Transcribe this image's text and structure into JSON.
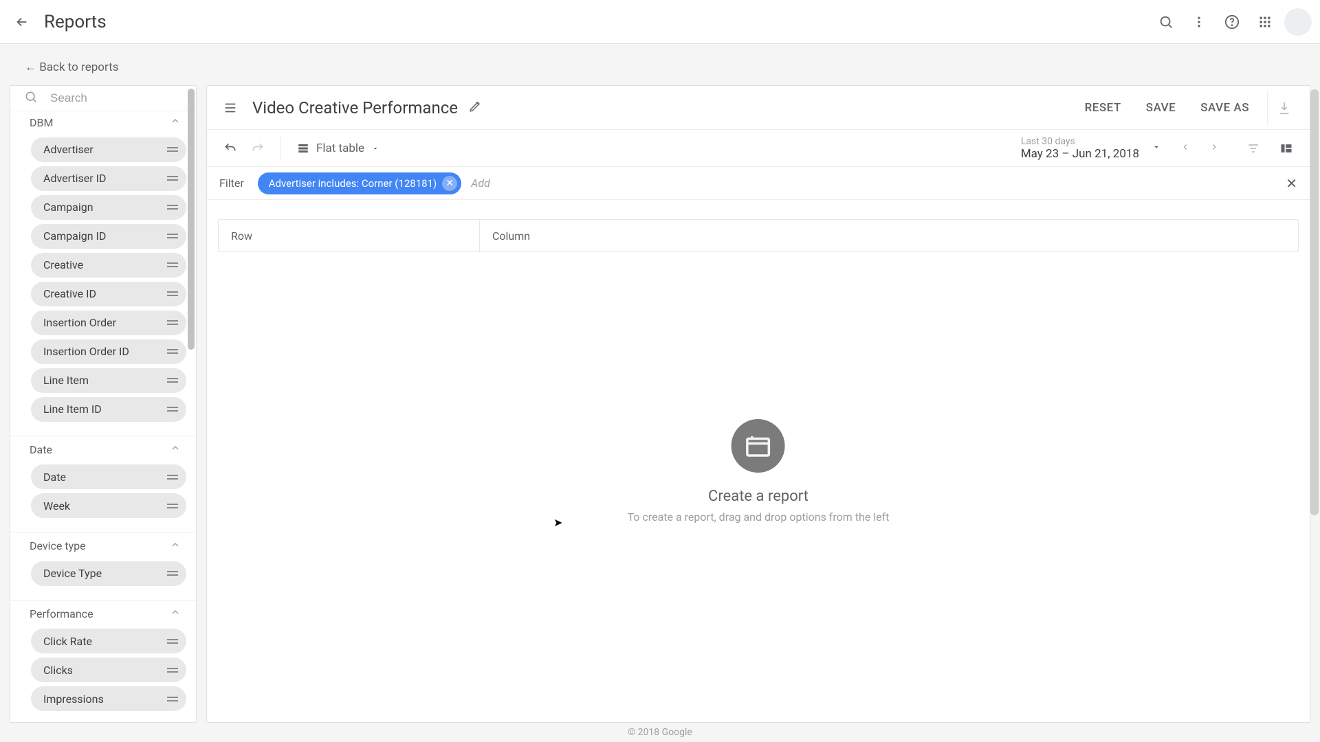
{
  "topbar": {
    "title": "Reports"
  },
  "breadcrumb": "← Back to reports",
  "search": {
    "placeholder": "Search"
  },
  "sidebar": {
    "groups": [
      {
        "name": "DBM",
        "items": [
          "Advertiser",
          "Advertiser ID",
          "Campaign",
          "Campaign ID",
          "Creative",
          "Creative ID",
          "Insertion Order",
          "Insertion Order ID",
          "Line Item",
          "Line Item ID"
        ]
      },
      {
        "name": "Date",
        "items": [
          "Date",
          "Week"
        ]
      },
      {
        "name": "Device type",
        "items": [
          "Device Type"
        ]
      },
      {
        "name": "Performance",
        "items": [
          "Click Rate",
          "Clicks",
          "Impressions"
        ]
      }
    ]
  },
  "report": {
    "title": "Video Creative Performance",
    "actions": {
      "reset": "RESET",
      "save": "SAVE",
      "save_as": "SAVE AS"
    }
  },
  "toolbar": {
    "table_type": "Flat table",
    "date_label": "Last 30 days",
    "date_range": "May 23 – Jun 21, 2018"
  },
  "filter": {
    "label": "Filter",
    "chip": "Advertiser includes: Corner (128181)",
    "add": "Add"
  },
  "drop": {
    "row": "Row",
    "column": "Column"
  },
  "empty": {
    "title": "Create a report",
    "subtitle": "To create a report, drag and drop options from the left"
  },
  "footer": "© 2018 Google"
}
